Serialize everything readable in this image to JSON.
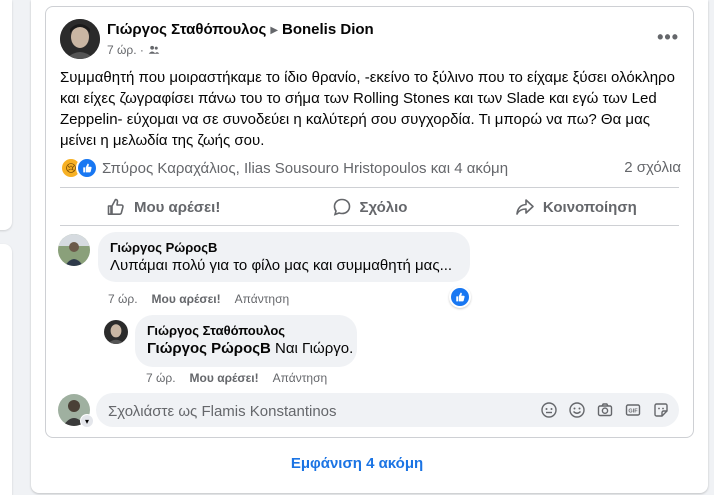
{
  "post": {
    "author": "Γιώργος Σταθόπουλος",
    "target": "Bonelis Dion",
    "time": "7 ώρ. ·",
    "text": "Συμμαθητή που μοιραστήκαμε το ίδιο θρανίο, -εκείνο το ξύλινο που το είχαμε ξύσει ολόκληρο και είχες ζωγραφίσει πάνω του το σήμα των Rolling Stones και των Slade και εγώ των Led Zeppelin- εύχομαι να σε συνοδεύει η καλύτερή σου συγχορδία. Τι μπορώ να πω? Θα μας μείνει η μελωδία της ζωής σου.",
    "reactions_names": "Σπύρος Καραχάλιος, Ilias Sousouro Hristopoulos και 4 ακόμη",
    "comments_count": "2 σχόλια",
    "more_icon": "•••"
  },
  "actions": {
    "like": "Μου αρέσει!",
    "comment": "Σχόλιο",
    "share": "Κοινοποίηση"
  },
  "comments": [
    {
      "name": "Γιώργος ΡώροςΒ",
      "text": "Λυπάμαι πολύ για το φίλο μας και συμμαθητή μας...",
      "time": "7 ώρ.",
      "like": "Μου αρέσει!",
      "reply": "Απάντηση"
    },
    {
      "name": "Γιώργος Σταθόπουλος",
      "mention": "Γιώργος ΡώροςΒ",
      "text": " Ναι Γιώργο.",
      "time": "7 ώρ.",
      "like": "Μου αρέσει!",
      "reply": "Απάντηση"
    }
  ],
  "composer": {
    "placeholder": "Σχολιάστε ως Flamis Konstantinos",
    "icons": [
      "avatar-icon",
      "emoji-icon",
      "camera-icon",
      "gif-icon",
      "sticker-icon"
    ]
  },
  "footer": {
    "show_more": "Εμφάνιση 4 ακόμη"
  },
  "colors": {
    "accent": "#1b74e4",
    "like_blue": "#1877f2",
    "bubble": "#f0f2f5"
  }
}
